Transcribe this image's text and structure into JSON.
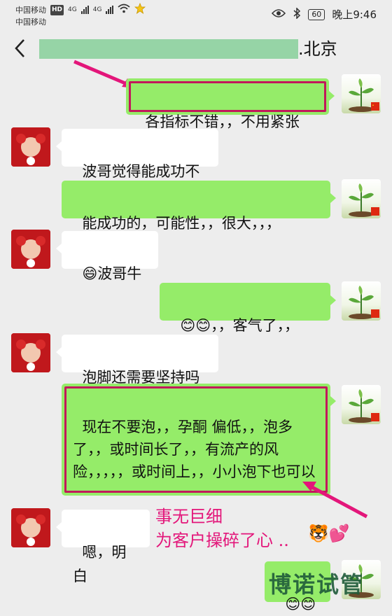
{
  "status": {
    "carrier1": "中国移动",
    "carrier1_badge": "HD",
    "carrier2": "中国移动",
    "net1": "4G",
    "net2": "4G",
    "battery": "60",
    "time": "晚上9:46"
  },
  "header": {
    "back_glyph": "<",
    "title_suffix": ".北京"
  },
  "messages": [
    {
      "side": "right",
      "text": "各指标不错，，不用紧张",
      "highlighted": true
    },
    {
      "side": "left",
      "text": "波哥觉得能成功不"
    },
    {
      "side": "right",
      "text": "能成功的，可能性，，很大，，，"
    },
    {
      "side": "left",
      "text": "😄波哥牛"
    },
    {
      "side": "right",
      "text": "😊😊，，客气了，，"
    },
    {
      "side": "left",
      "text": "泡脚还需要坚持吗"
    },
    {
      "side": "right",
      "text": "现在不要泡，，孕酮 偏低，，泡多了，，或时间长了，，有流产的风险，，，，，或时间上，，小小泡下也可以",
      "highlighted": true
    },
    {
      "side": "left",
      "text": "嗯，明白"
    },
    {
      "side": "right",
      "text": "😊😊"
    }
  ],
  "annotation": {
    "line1": "事无巨细",
    "line2": "为客户操碎了心 ..",
    "emoji": "🐯💕"
  },
  "watermark": "博诺试管",
  "colors": {
    "background": "#ededed",
    "right_bubble": "#95ec69",
    "left_bubble": "#ffffff",
    "highlight": "#c2185b",
    "annotation_text": "#e3167a",
    "masked_name": "#96d4a6"
  }
}
